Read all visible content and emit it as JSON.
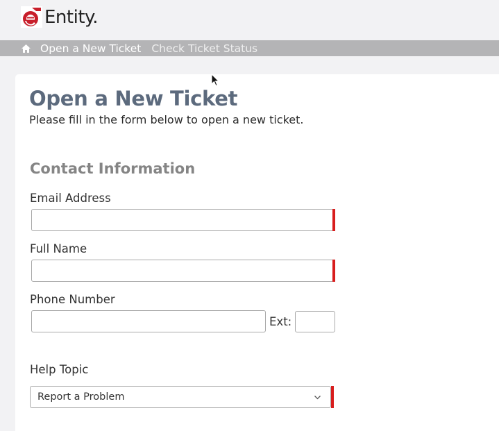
{
  "brand": {
    "name": "Entity.",
    "accent_color": "#c81e2a"
  },
  "nav": {
    "home_icon": "home-icon",
    "open_ticket": "Open a New Ticket",
    "check_status": "Check Ticket Status"
  },
  "page": {
    "title": "Open a New Ticket",
    "subtitle": "Please fill in the form below to open a new ticket."
  },
  "contact": {
    "section_title": "Contact Information",
    "email_label": "Email Address",
    "email_value": "",
    "name_label": "Full Name",
    "name_value": "",
    "phone_label": "Phone Number",
    "phone_value": "",
    "ext_label": "Ext:",
    "ext_value": ""
  },
  "help_topic": {
    "label": "Help Topic",
    "selected": "Report a Problem"
  },
  "colors": {
    "nav_bg": "#b4b4b6",
    "title": "#5c6a7d",
    "required": "#d81d1d"
  }
}
